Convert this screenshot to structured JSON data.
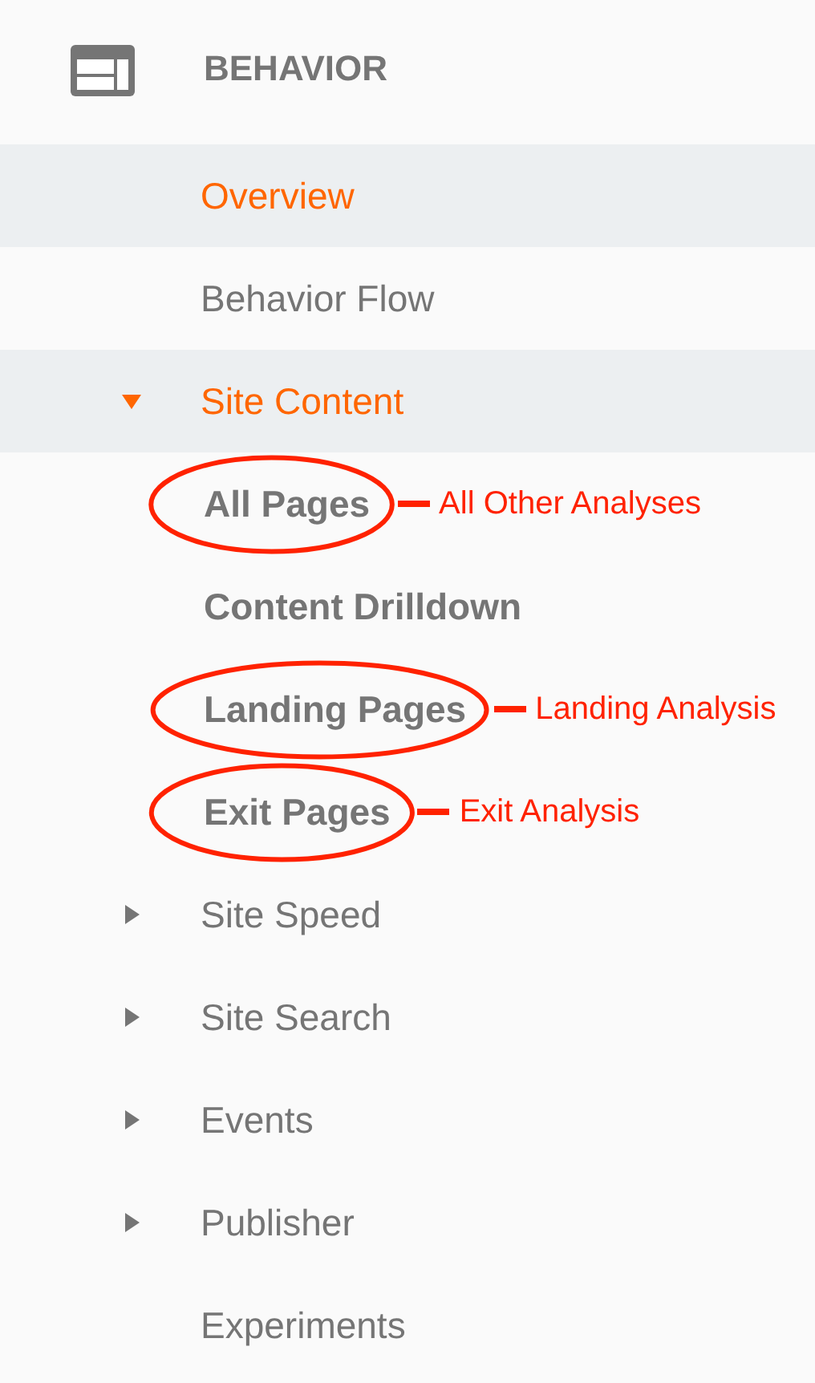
{
  "header": {
    "title": "BEHAVIOR"
  },
  "items": [
    {
      "label": "Overview",
      "kind": "link",
      "selected": true
    },
    {
      "label": "Behavior Flow",
      "kind": "link",
      "selected": false
    },
    {
      "label": "Site Content",
      "kind": "group",
      "selected": true,
      "expanded": true,
      "children": [
        {
          "label": "All Pages",
          "annotation": "All Other Analyses"
        },
        {
          "label": "Content Drilldown"
        },
        {
          "label": "Landing Pages",
          "annotation": "Landing Analysis"
        },
        {
          "label": "Exit Pages",
          "annotation": "Exit Analysis"
        }
      ]
    },
    {
      "label": "Site Speed",
      "kind": "group",
      "selected": false,
      "expanded": false
    },
    {
      "label": "Site Search",
      "kind": "group",
      "selected": false,
      "expanded": false
    },
    {
      "label": "Events",
      "kind": "group",
      "selected": false,
      "expanded": false
    },
    {
      "label": "Publisher",
      "kind": "group",
      "selected": false,
      "expanded": false
    },
    {
      "label": "Experiments",
      "kind": "link",
      "selected": false
    }
  ]
}
